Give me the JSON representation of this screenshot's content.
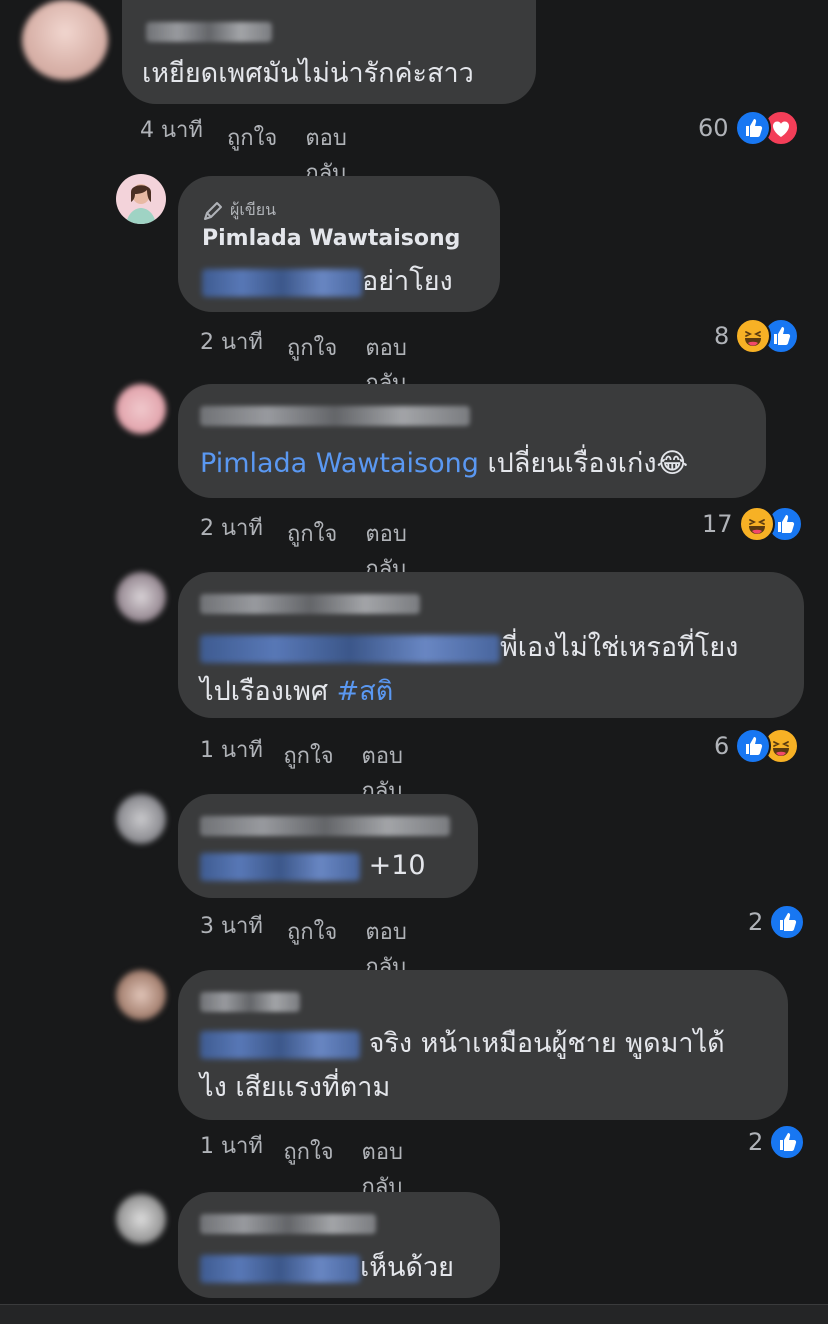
{
  "colors": {
    "background": "#18191a",
    "bubble": "#3a3b3c",
    "link": "#5a98f2",
    "like": "#1877f2",
    "love": "#f33e58",
    "haha": "#f7b125"
  },
  "comments": [
    {
      "text": "เหยียดเพศมันไม่น่ารักค่ะสาว",
      "time": "4 นาที",
      "like": "ถูกใจ",
      "reply": "ตอบกลับ",
      "count": "60",
      "reactions": [
        "like-icon",
        "love-icon"
      ]
    },
    {
      "author_tag": "ผู้เขียน",
      "author": "Pimlada Wawtaisong",
      "text": "อย่าโยง",
      "time": "2 นาที",
      "like": "ถูกใจ",
      "reply": "ตอบกลับ",
      "count": "8",
      "reactions": [
        "haha-icon",
        "like-icon"
      ]
    },
    {
      "mention": "Pimlada Wawtaisong",
      "text": " เปลี่ยนเรื่องเก่ง😂",
      "time": "2 นาที",
      "like": "ถูกใจ",
      "reply": "ตอบกลับ",
      "count": "17",
      "reactions": [
        "haha-icon",
        "like-icon"
      ]
    },
    {
      "text": "พี่เองไม่ใช่เหรอที่โยง",
      "text2": "ไปเรืองเพศ ",
      "hashtag": "#สติ",
      "time": "1 นาที",
      "like": "ถูกใจ",
      "reply": "ตอบกลับ",
      "count": "6",
      "reactions": [
        "like-icon",
        "haha-icon"
      ]
    },
    {
      "text": "+10",
      "time": "3 นาที",
      "like": "ถูกใจ",
      "reply": "ตอบกลับ",
      "count": "2",
      "reactions": [
        "like-icon"
      ]
    },
    {
      "text": "จริง หน้าเหมือนผู้ชาย พูดมาได้",
      "text2": "ไง เสียแรงที่ตาม",
      "time": "1 นาที",
      "like": "ถูกใจ",
      "reply": "ตอบกลับ",
      "count": "2",
      "reactions": [
        "like-icon"
      ]
    },
    {
      "text": "เห็นด้วย"
    }
  ]
}
